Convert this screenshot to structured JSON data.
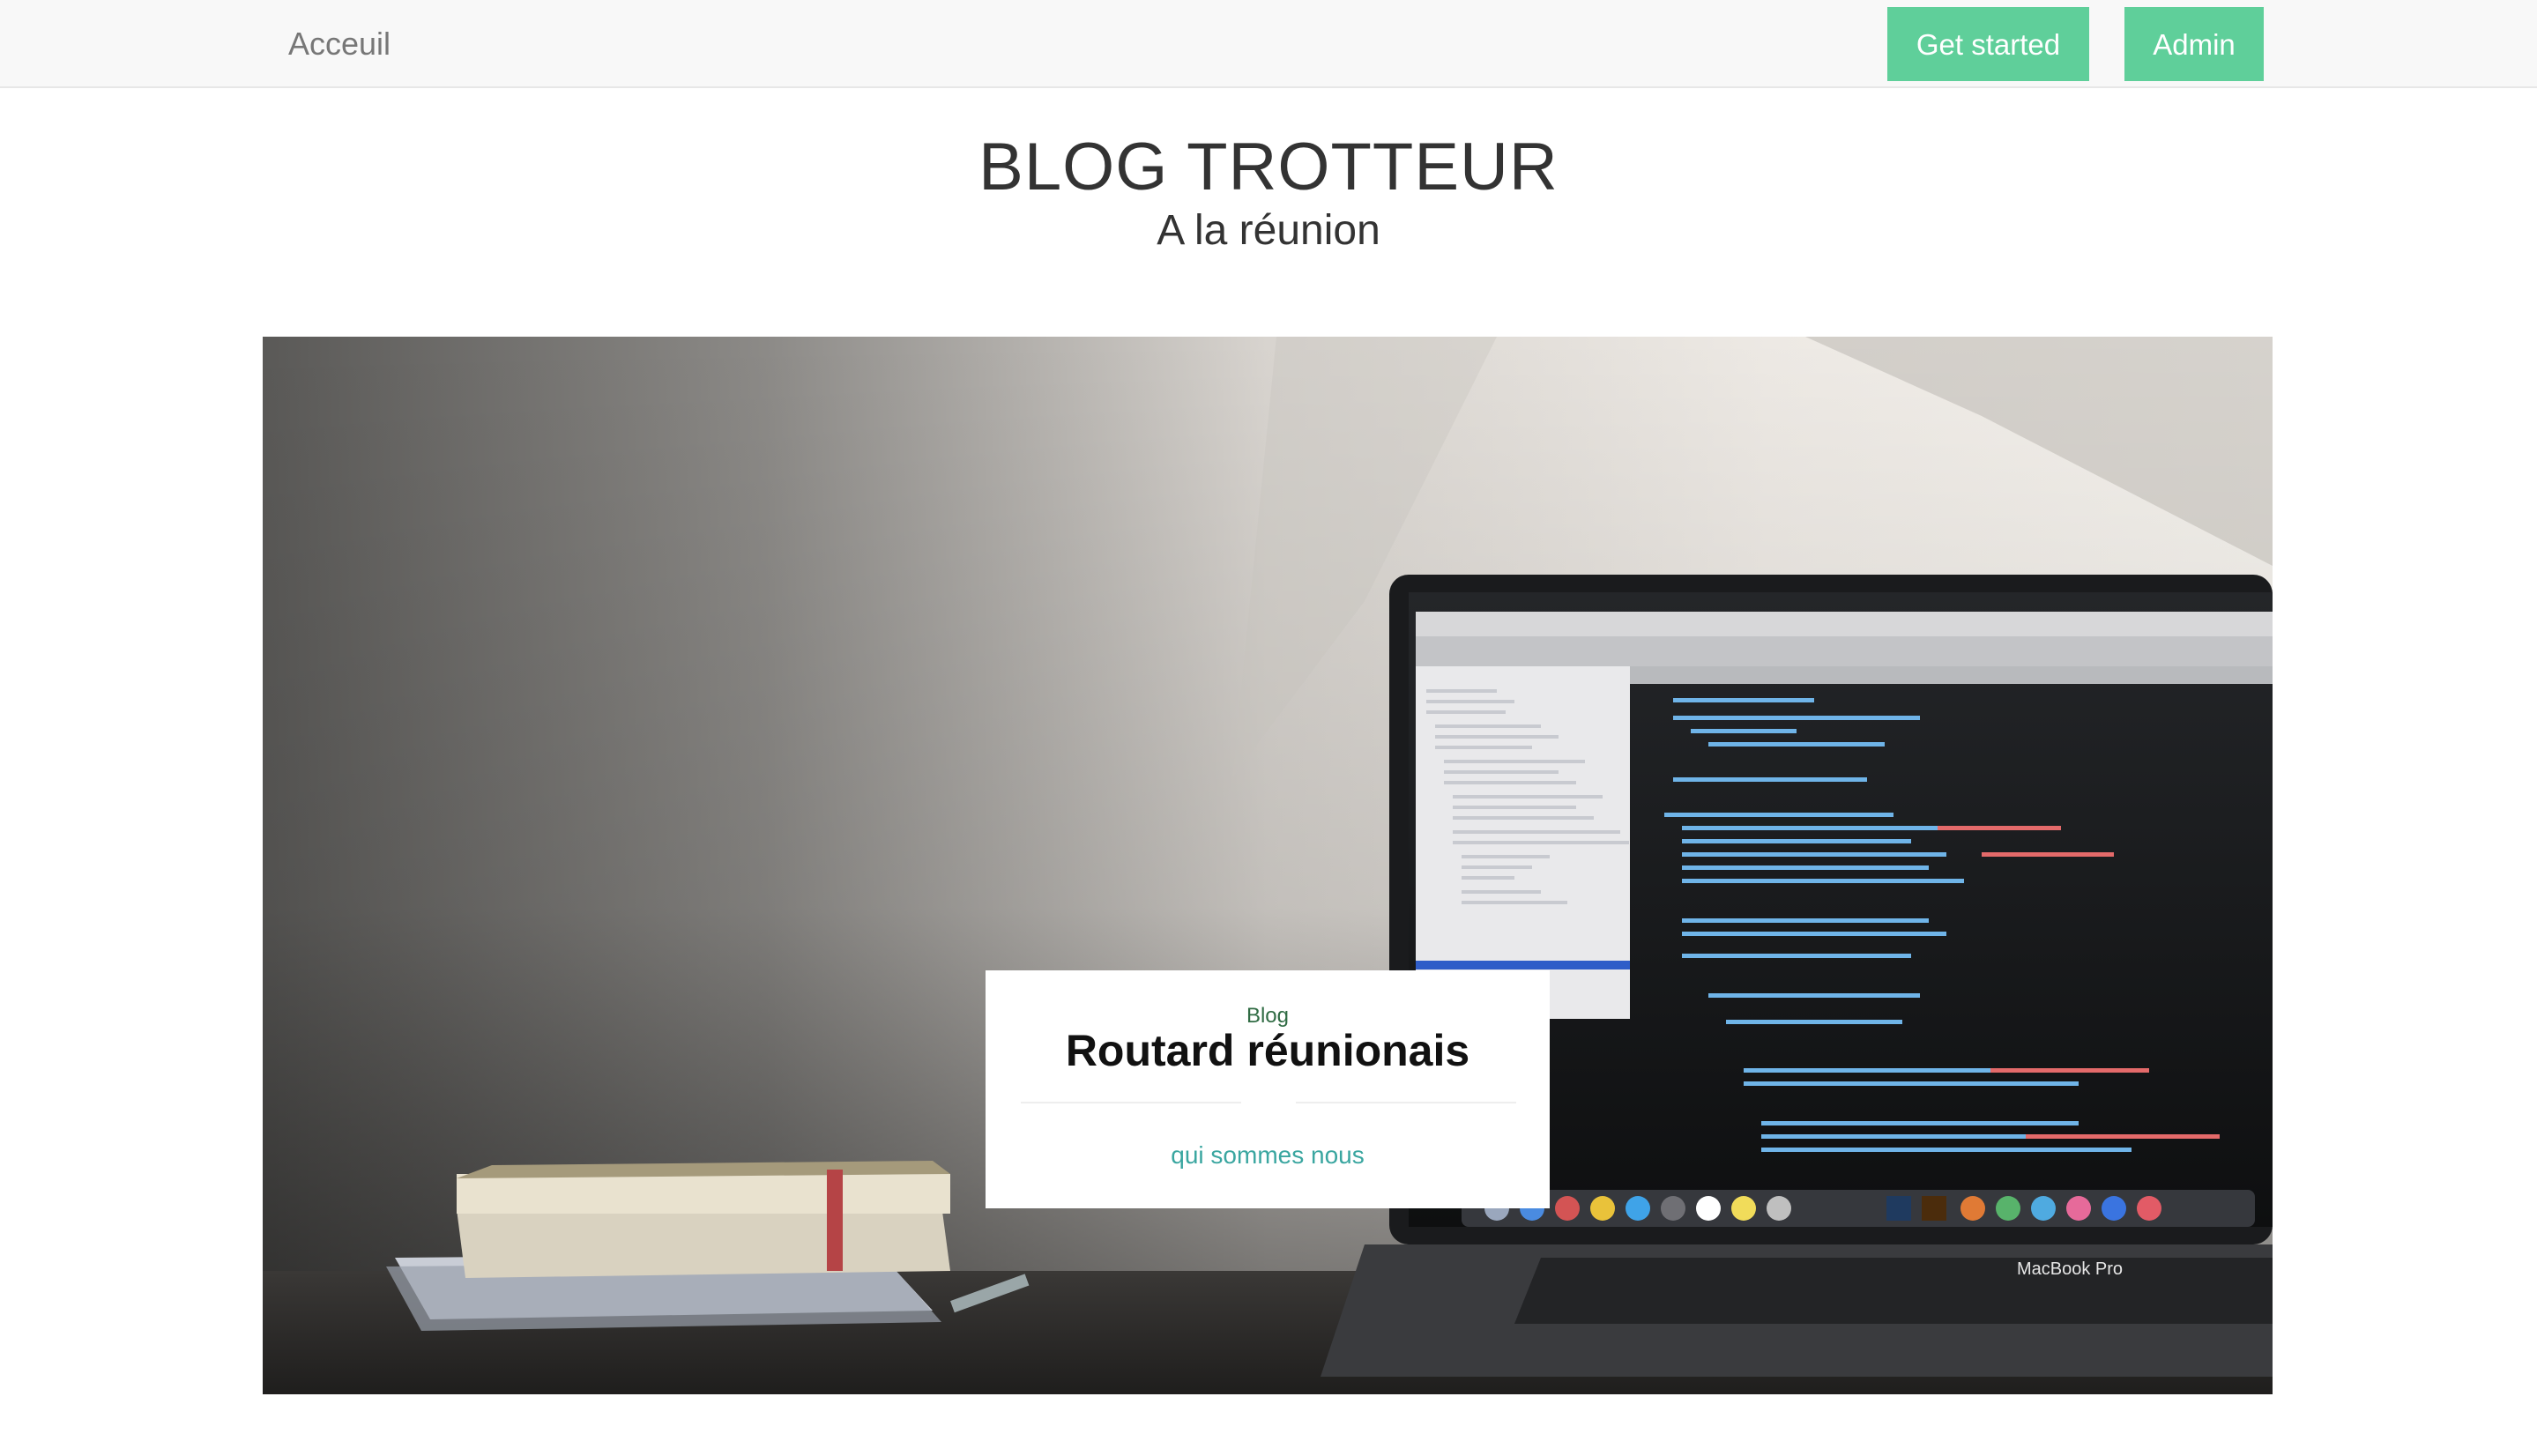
{
  "navbar": {
    "home_label": "Acceuil",
    "get_started_label": "Get started",
    "admin_label": "Admin",
    "accent_color": "#5fcf9a"
  },
  "header": {
    "title": "BLOG TROTTEUR",
    "subtitle": "A la réunion"
  },
  "hero": {
    "laptop_brand": "MacBook Pro",
    "card": {
      "kicker": "Blog",
      "title": "Routard réunionais",
      "link_label": "qui sommes nous"
    }
  }
}
